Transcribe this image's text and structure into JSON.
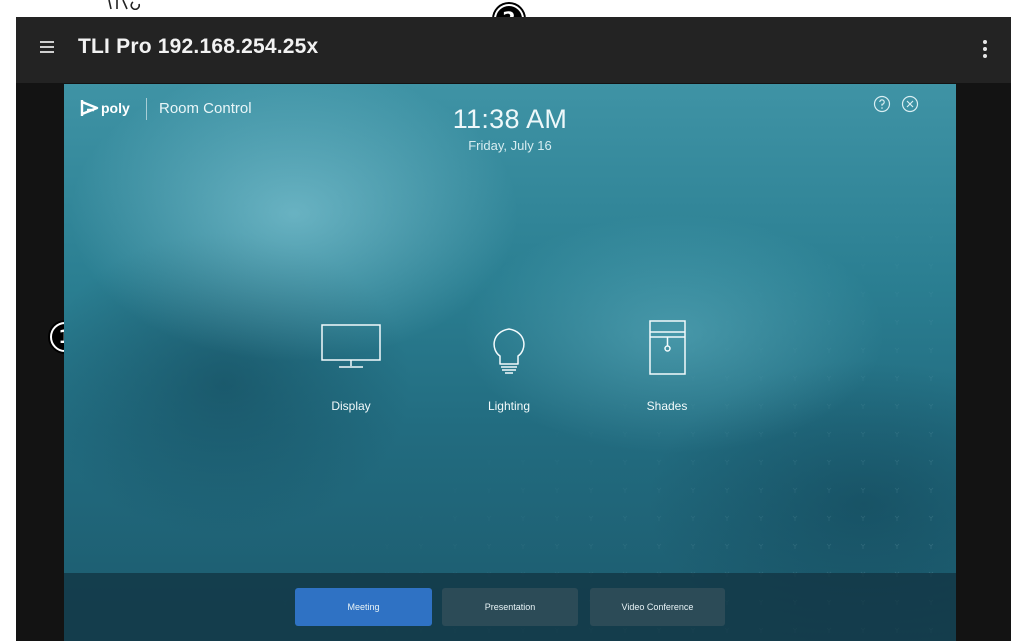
{
  "callouts": {
    "one": "1",
    "two": "2"
  },
  "app": {
    "title": "TLI Pro 192.168.254.25x",
    "icons": {
      "menu": "hamburger-menu-icon",
      "more": "kebab-menu-icon"
    }
  },
  "room_control": {
    "brand": "poly",
    "product": "Room Control",
    "time": "11:38 AM",
    "date": "Friday, July 16",
    "header_icons": [
      "help-icon",
      "close-icon"
    ],
    "tiles": [
      {
        "label": "Display",
        "icon": "monitor-icon"
      },
      {
        "label": "Lighting",
        "icon": "lightbulb-icon"
      },
      {
        "label": "Shades",
        "icon": "window-shade-icon"
      }
    ],
    "modes": [
      {
        "label": "Meeting",
        "active": true
      },
      {
        "label": "Presentation",
        "active": false
      },
      {
        "label": "Video Conference",
        "active": false
      }
    ],
    "colors": {
      "active_mode": "#2f72c4",
      "inactive_mode": "#2c4b57",
      "background": "#2b7f92"
    }
  }
}
